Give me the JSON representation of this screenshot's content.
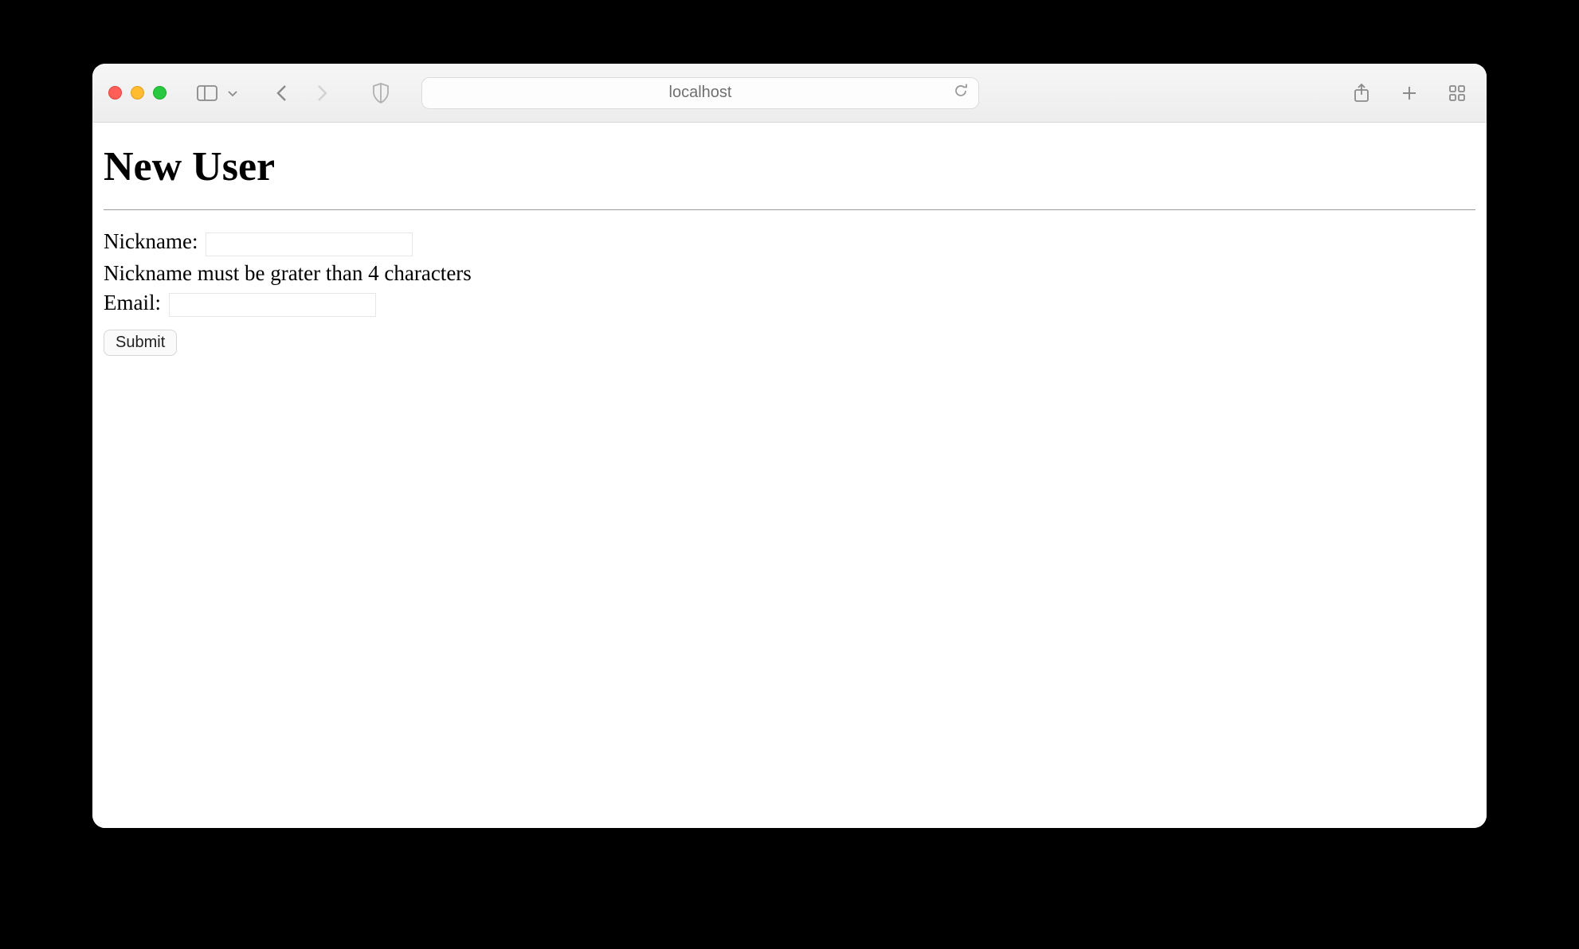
{
  "browser": {
    "address": "localhost",
    "icons": {
      "close": "close-icon",
      "minimize": "minimize-icon",
      "zoom": "zoom-icon",
      "sidebar": "sidebar-icon",
      "dropdown": "chevron-down-icon",
      "back": "chevron-left-icon",
      "forward": "chevron-right-icon",
      "shield": "shield-icon",
      "reload": "reload-icon",
      "share": "share-icon",
      "newtab": "plus-icon",
      "tabs": "grid-icon"
    }
  },
  "page": {
    "heading": "New User",
    "form": {
      "nickname": {
        "label": "Nickname:",
        "value": "",
        "error": "Nickname must be grater than 4 characters"
      },
      "email": {
        "label": "Email:",
        "value": ""
      },
      "submit_label": "Submit"
    }
  }
}
